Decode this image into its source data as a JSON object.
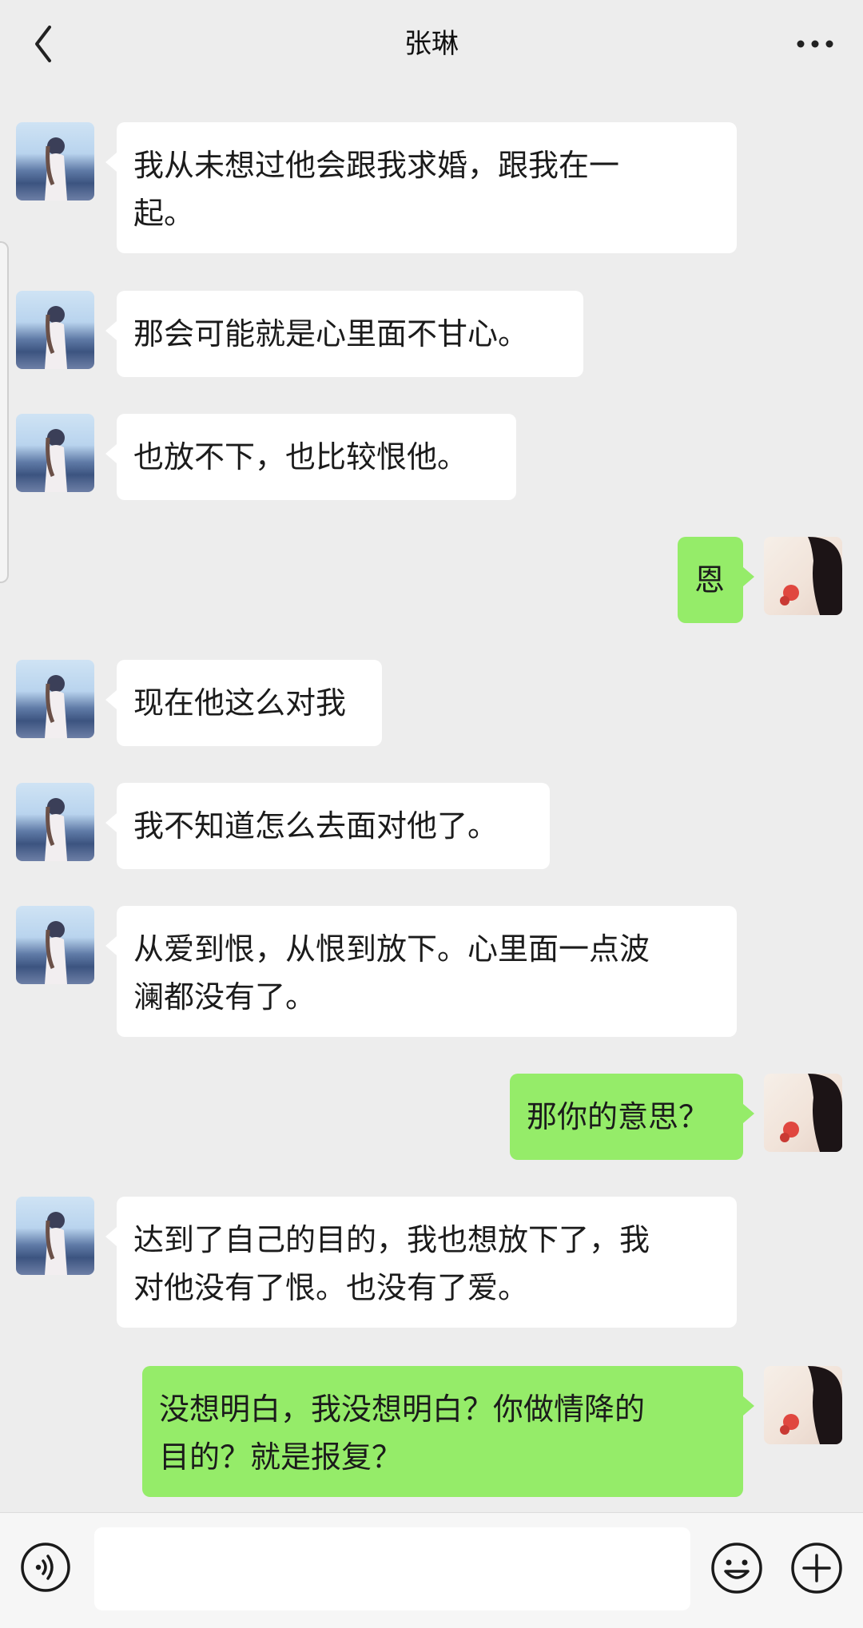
{
  "header": {
    "title": "张琳"
  },
  "messages": [
    {
      "side": "left",
      "text": "我从未想过他会跟我求婚，跟我在一\n起。"
    },
    {
      "side": "left",
      "text": "那会可能就是心里面不甘心。"
    },
    {
      "side": "left",
      "text": "也放不下，也比较恨他。"
    },
    {
      "side": "right",
      "text": "恩"
    },
    {
      "side": "left",
      "text": "现在他这么对我"
    },
    {
      "side": "left",
      "text": "我不知道怎么去面对他了。"
    },
    {
      "side": "left",
      "text": "从爱到恨，从恨到放下。心里面一点波\n澜都没有了。"
    },
    {
      "side": "right",
      "text": "那你的意思？"
    },
    {
      "side": "left",
      "text": "达到了自己的目的，我也想放下了，我\n对他没有了恨。也没有了爱。"
    },
    {
      "side": "right",
      "text": "没想明白，我没想明白？你做情降的\n目的？就是报复？"
    }
  ],
  "composer": {
    "input_value": "",
    "voice_icon": "voice-icon",
    "emoji_icon": "emoji-icon",
    "plus_icon": "plus-icon"
  },
  "colors": {
    "background": "#ededed",
    "bubble_self": "#95ec69",
    "bubble_other": "#ffffff"
  }
}
